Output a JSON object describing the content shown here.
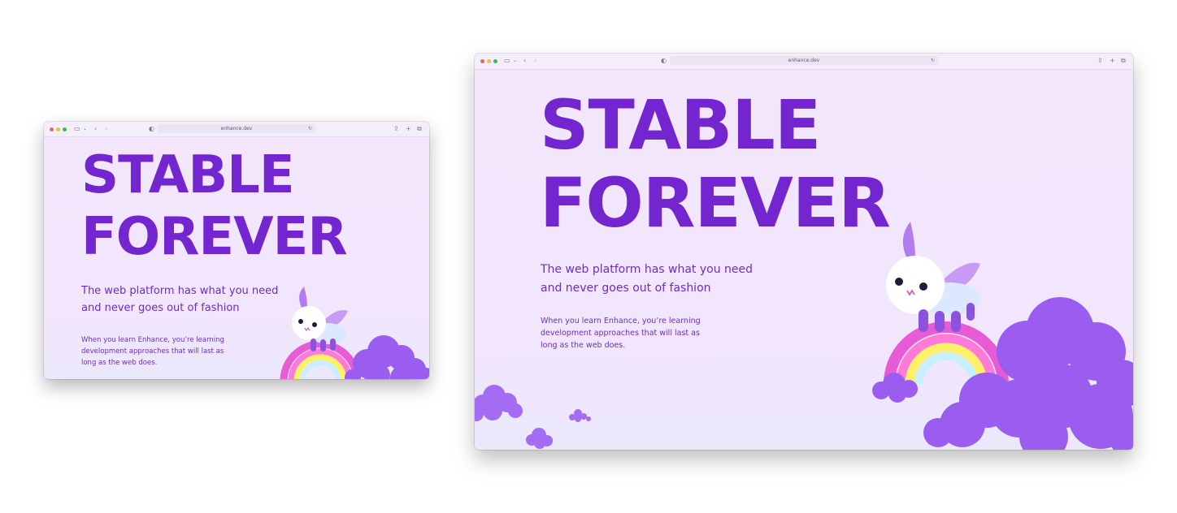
{
  "browser": {
    "url": "enhance.dev",
    "toolbar_icons": [
      "sidebar-icon",
      "chevron-down-icon",
      "back-icon",
      "forward-icon",
      "shield-icon",
      "lock-icon",
      "reload-icon",
      "share-icon",
      "new-tab-icon",
      "tabs-overview-icon"
    ]
  },
  "hero": {
    "line1": "STABLE",
    "line2": "FOREVER",
    "subtitle_line1": "The web platform has what you need",
    "subtitle_line2": "and never goes out of fashion",
    "body_line1": "When you learn Enhance, you’re learning",
    "body_line2": "development approaches that will last as",
    "body_line3": "long as the web does."
  },
  "colors": {
    "accent": "#7326d0",
    "text": "#6a2fbe",
    "background": "#f1e6fb",
    "cloud": "#9b5cf0"
  }
}
